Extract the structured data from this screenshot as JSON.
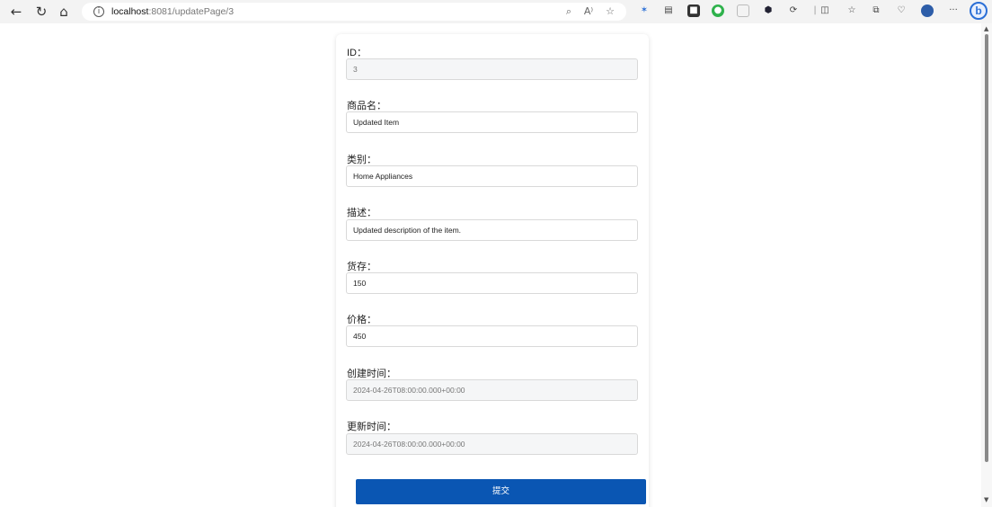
{
  "browser": {
    "url_host": "localhost",
    "url_rest": ":8081/updatePage/3",
    "icons": {
      "back": "←",
      "refresh": "↻",
      "home": "⌂",
      "info": "i",
      "read_aloud": "A⁾",
      "favorite": "☆",
      "more": "···",
      "copilot": "b"
    }
  },
  "form": {
    "id": {
      "label": "ID：",
      "value": "3"
    },
    "name": {
      "label": "商品名：",
      "value": "Updated Item"
    },
    "category": {
      "label": "类别：",
      "value": "Home Appliances"
    },
    "description": {
      "label": "描述：",
      "value": "Updated description of the item."
    },
    "stock": {
      "label": "货存：",
      "value": "150"
    },
    "price": {
      "label": "价格：",
      "value": "450"
    },
    "created_at": {
      "label": "创建时间：",
      "value": "2024-04-26T08:00:00.000+00:00"
    },
    "updated_at": {
      "label": "更新时间：",
      "value": "2024-04-26T08:00:00.000+00:00"
    },
    "submit_label": "提交"
  },
  "colors": {
    "primary": "#0a56b3",
    "readonly_bg": "#f5f6f7"
  }
}
